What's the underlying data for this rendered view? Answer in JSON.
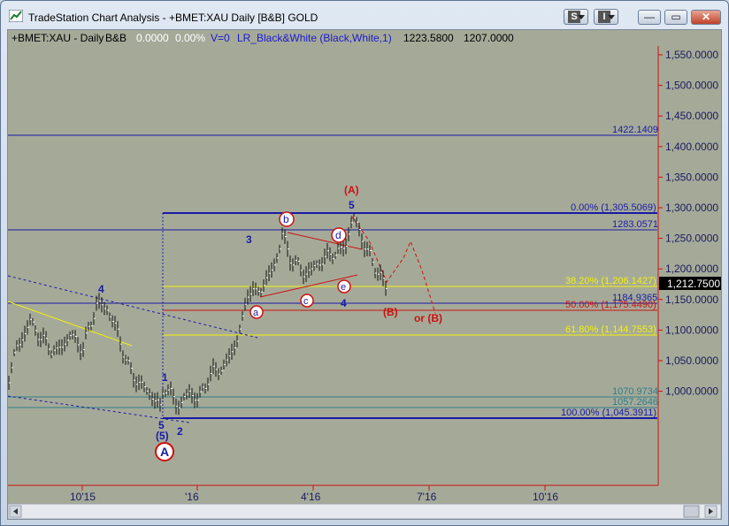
{
  "window": {
    "title": "TradeStation Chart Analysis - +BMET:XAU Daily [B&B] GOLD",
    "buttons": {
      "s_label": "S",
      "i_label": "I",
      "minimize": "—",
      "restore": "▭",
      "close": "✕"
    }
  },
  "status_line": {
    "symbol": "+BMET:XAU - Daily",
    "bb": "B&B",
    "val1": "0.0000",
    "val2": "0.00%",
    "v": "V=0",
    "indicator": "LR_Black&White (Black,White,1)",
    "num1": "1223.5800",
    "num2": "1207.0000"
  },
  "price_axis": {
    "ticks": [
      "1,550.0000",
      "1,500.0000",
      "1,450.0000",
      "1,400.0000",
      "1,350.0000",
      "1,300.0000",
      "1,250.0000",
      "1,200.0000",
      "1,150.0000",
      "1,100.0000",
      "1,050.0000",
      "1,000.0000"
    ],
    "last_price": "1,212.7500"
  },
  "time_axis": {
    "ticks": [
      "10'15",
      "'16",
      "4'16",
      "7'16",
      "10'16"
    ]
  },
  "levels": {
    "l1422": "1422.1409",
    "fib0": "0.00% (1,305.5069)",
    "l1283": "1283.0571",
    "fib38": "38.20% (1,206.1427)",
    "l1184": "1184.9365",
    "fib50": "50.00% (1,175.4490)",
    "fib618": "61.80% (1,144.7553)",
    "l1070": "1070.9734",
    "l1057": "1057.2646",
    "fib100": "100.00% (1,045.3911)"
  },
  "wave_labels": {
    "A_top": "(A)",
    "five_top": "5",
    "three": "3",
    "four_left": "4",
    "one": "1",
    "two": "2",
    "five_bottom": "5",
    "paren5": "(5)",
    "A_circle": "A",
    "a": "a",
    "b": "b",
    "c": "c",
    "d": "d",
    "e": "e",
    "four_mid": "4",
    "B_paren": "(B)",
    "or_B": "or (B)"
  },
  "colors": {
    "background": "#a5aa98",
    "blue": "#1a1aa8",
    "red": "#cc1111",
    "yellow": "#f2f20a",
    "teal": "#2e7d8c"
  }
}
